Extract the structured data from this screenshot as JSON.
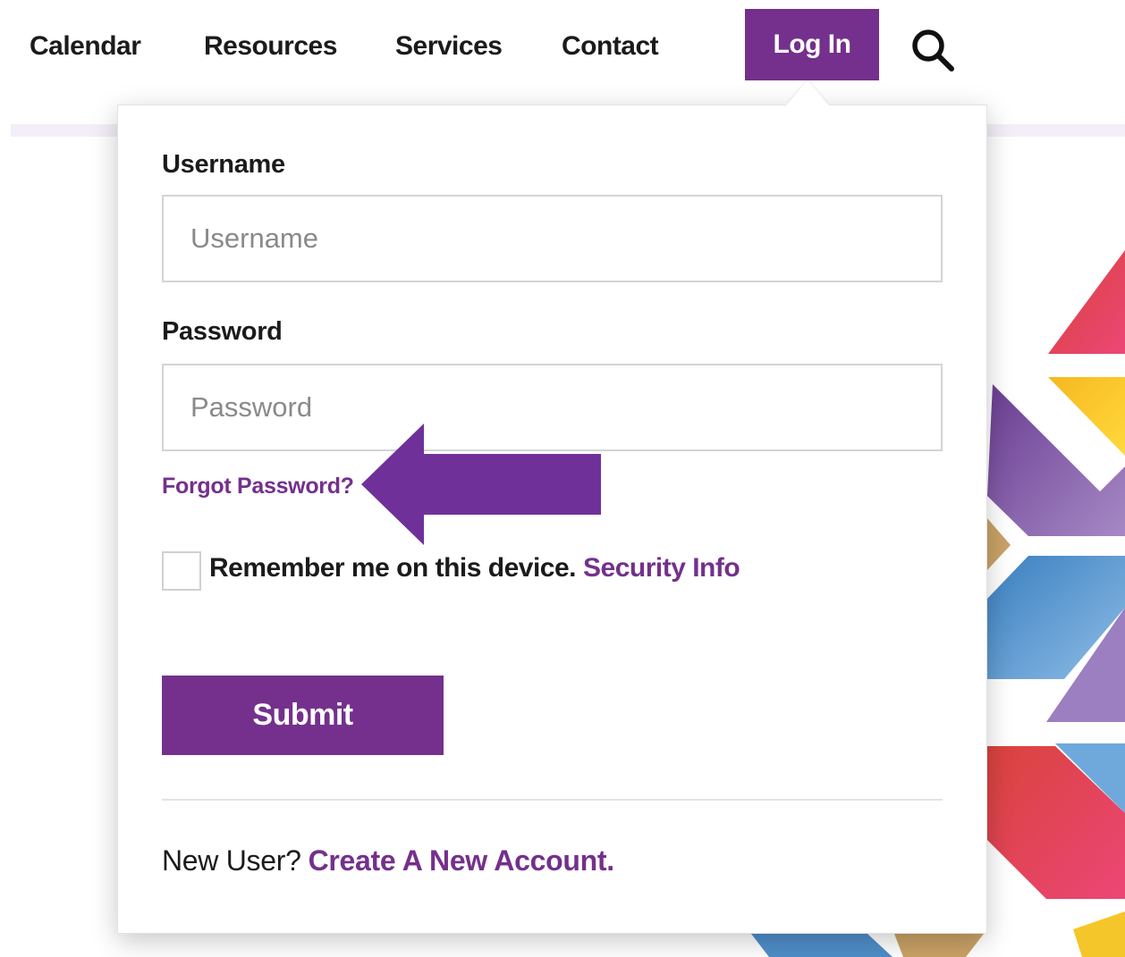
{
  "nav": {
    "items": [
      {
        "label": "Calendar"
      },
      {
        "label": "Resources"
      },
      {
        "label": "Services"
      },
      {
        "label": "Contact"
      }
    ],
    "login_label": "Log In",
    "search_icon": "search-icon"
  },
  "login_form": {
    "username_label": "Username",
    "username_placeholder": "Username",
    "username_value": "",
    "password_label": "Password",
    "password_placeholder": "Password",
    "password_value": "",
    "forgot_password_label": "Forgot Password?",
    "remember_label": "Remember me on this device.",
    "remember_checked": false,
    "security_info_label": "Security Info",
    "submit_label": "Submit",
    "new_user_label": "New User?",
    "create_account_label": "Create A New Account."
  },
  "annotation": {
    "icon": "left-arrow-icon",
    "color": "#70309a"
  },
  "colors": {
    "brand_purple": "#74308c",
    "text_dark": "#1b1b1b",
    "placeholder_gray": "#8a8a8a",
    "art_red": "#e2455e",
    "art_yellow": "#f5c62a",
    "art_purple": "#7d4fa0",
    "art_blue": "#4f8ec9",
    "art_tan": "#c9a266"
  }
}
